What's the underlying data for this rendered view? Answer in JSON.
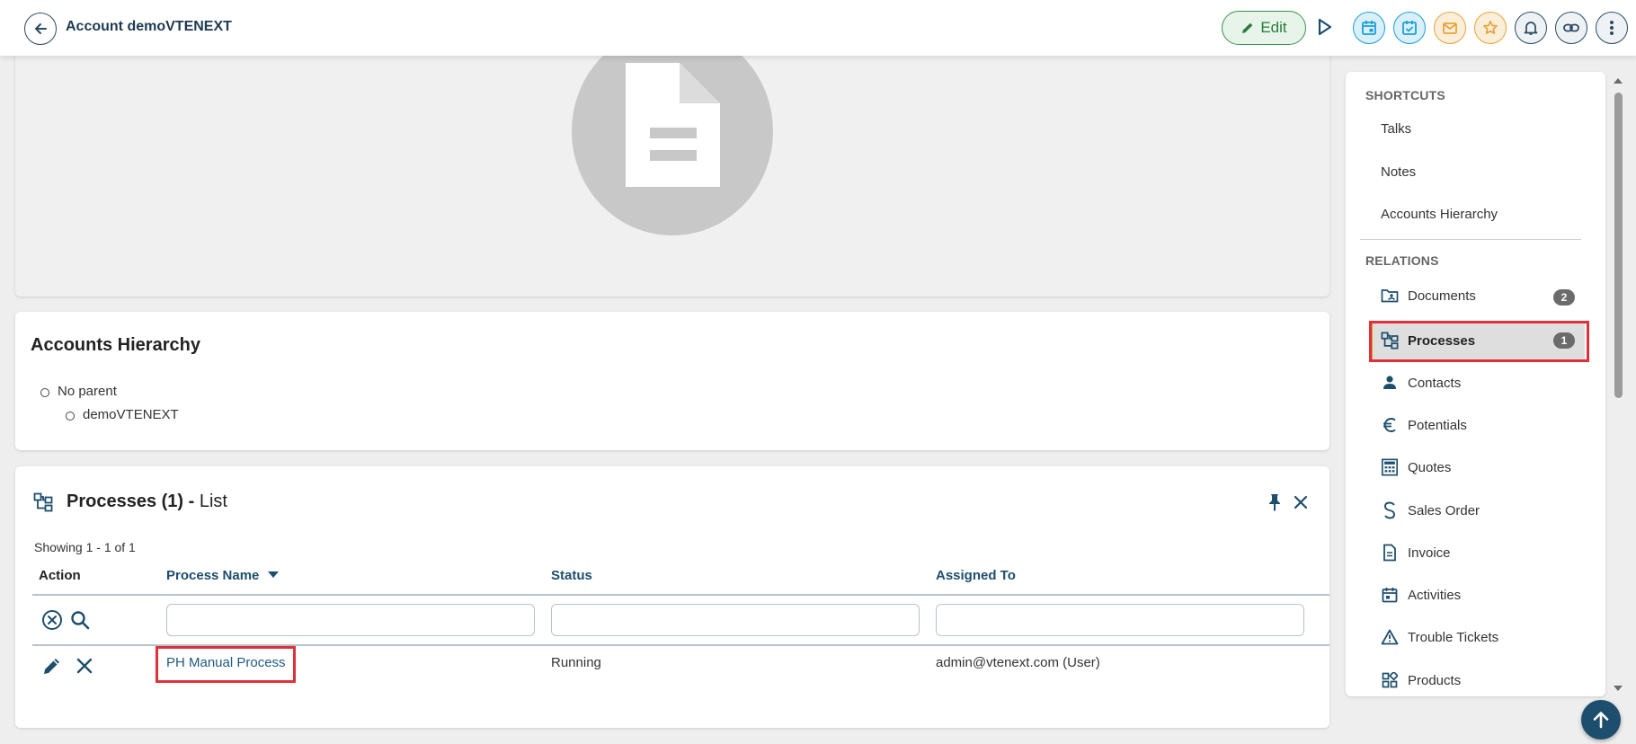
{
  "header": {
    "title": "Account demoVTENEXT",
    "edit_label": "Edit",
    "icons": [
      "back-arrow-icon",
      "pencil-icon",
      "play-icon",
      "calendar-icon",
      "task-check-icon",
      "mail-icon",
      "star-icon",
      "bell-icon",
      "link-icon",
      "more-vertical-icon"
    ],
    "colors": {
      "blue": "#1c9fd7",
      "orange": "#e9a23b",
      "green": "#3f8f4f",
      "navy": "#1e4e6d"
    }
  },
  "hierarchy": {
    "title": "Accounts Hierarchy",
    "parent": "No parent",
    "child": "demoVTENEXT"
  },
  "processes": {
    "title_bold": "Processes (1) -",
    "title_rest": "List",
    "showing": "Showing 1 - 1 of 1",
    "columns": {
      "action": "Action",
      "process_name": "Process Name",
      "status": "Status",
      "assigned_to": "Assigned To"
    },
    "rows": [
      {
        "process_name": "PH Manual Process",
        "status": "Running",
        "assigned_to": "admin@vtenext.com (User)"
      }
    ]
  },
  "sidebar": {
    "shortcuts_label": "SHORTCUTS",
    "shortcuts": [
      "Talks",
      "Notes",
      "Accounts Hierarchy"
    ],
    "relations_label": "RELATIONS",
    "relations": [
      {
        "label": "Documents",
        "badge": "2",
        "icon": "folder-user-icon"
      },
      {
        "label": "Processes",
        "badge": "1",
        "icon": "process-tree-icon",
        "active": true
      },
      {
        "label": "Contacts",
        "icon": "person-icon"
      },
      {
        "label": "Potentials",
        "icon": "euro-icon"
      },
      {
        "label": "Quotes",
        "icon": "calculator-icon"
      },
      {
        "label": "Sales Order",
        "icon": "dollar-icon"
      },
      {
        "label": "Invoice",
        "icon": "document-icon"
      },
      {
        "label": "Activities",
        "icon": "calendar-icon"
      },
      {
        "label": "Trouble Tickets",
        "icon": "warning-icon"
      },
      {
        "label": "Products",
        "icon": "products-grid-icon"
      }
    ],
    "accent_color": "#e59a1a",
    "highlight_color": "#e0303a"
  }
}
